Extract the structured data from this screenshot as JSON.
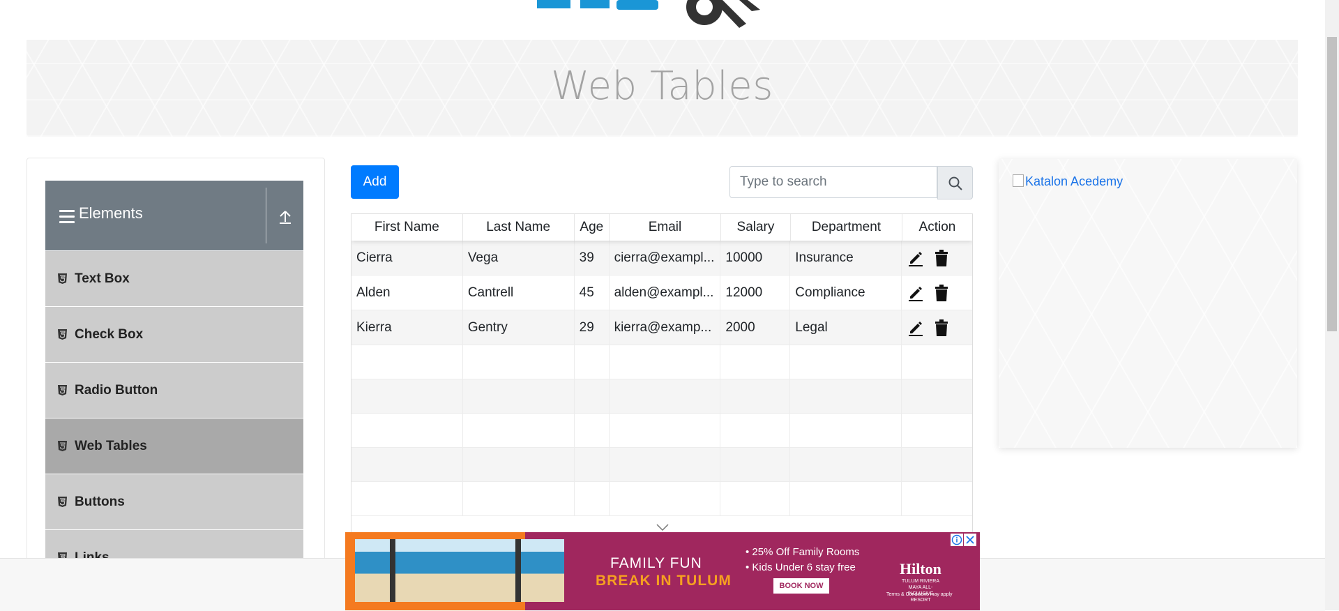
{
  "page": {
    "title": "Web Tables"
  },
  "sidebar": {
    "group_title": "Elements",
    "items": [
      {
        "label": "Text Box"
      },
      {
        "label": "Check Box"
      },
      {
        "label": "Radio Button"
      },
      {
        "label": "Web Tables"
      },
      {
        "label": "Buttons"
      },
      {
        "label": "Links"
      }
    ],
    "active_item": "Web Tables"
  },
  "toolbar": {
    "add_label": "Add",
    "search_placeholder": "Type to search"
  },
  "table": {
    "columns": [
      "First Name",
      "Last Name",
      "Age",
      "Email",
      "Salary",
      "Department",
      "Action"
    ],
    "rows": [
      {
        "first": "Cierra",
        "last": "Vega",
        "age": "39",
        "email": "cierra@exampl...",
        "salary": "10000",
        "department": "Insurance"
      },
      {
        "first": "Alden",
        "last": "Cantrell",
        "age": "45",
        "email": "alden@exampl...",
        "salary": "12000",
        "department": "Compliance"
      },
      {
        "first": "Kierra",
        "last": "Gentry",
        "age": "29",
        "email": "kierra@examp...",
        "salary": "2000",
        "department": "Legal"
      }
    ]
  },
  "right_panel": {
    "image_alt": "Katalon Acedemy"
  },
  "ad": {
    "title": "FAMILY FUN",
    "subtitle": "BREAK IN TULUM",
    "bullets": [
      "• 25% Off Family Rooms",
      "• Kids Under 6 stay free"
    ],
    "cta": "BOOK NOW",
    "brand": "Hilton",
    "brand_sub": "TULUM RIVIERA MAYA ALL-INCLUSIVE RESORT",
    "terms": "Terms & Conditions may apply"
  },
  "colors": {
    "primary": "#007bff",
    "sidebar_header": "#707b84",
    "sidebar_item": "#cccccc",
    "sidebar_active": "#a9a9a9",
    "ad_bg": "#a0275e"
  }
}
